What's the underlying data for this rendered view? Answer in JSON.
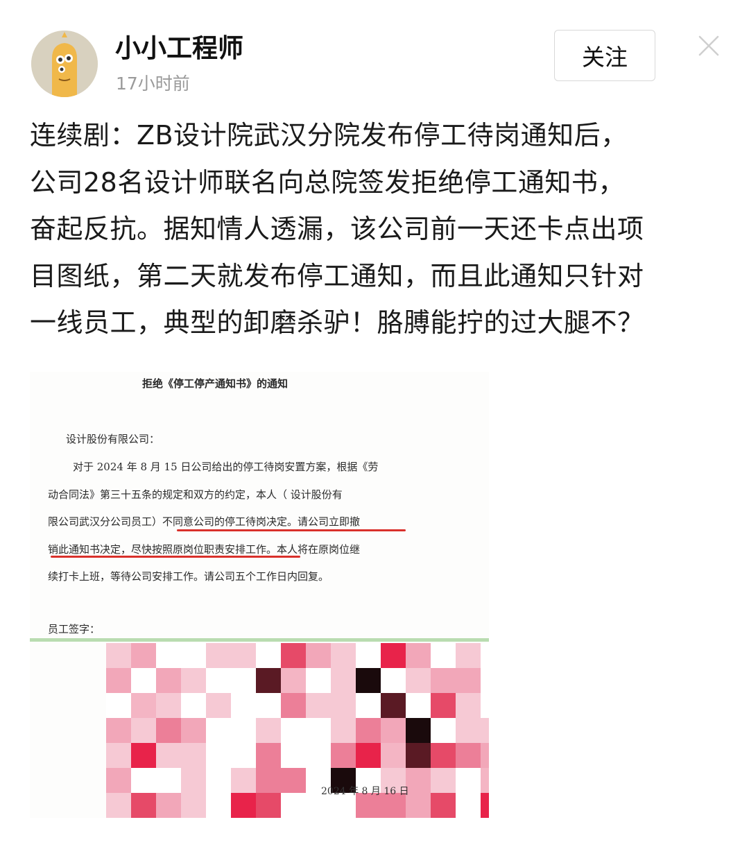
{
  "header": {
    "author_name": "小小工程师",
    "post_time": "17小时前",
    "follow_label": "关注",
    "avatar_icon": "avatar-character-icon",
    "close_icon": "close-icon"
  },
  "post": {
    "lines": [
      "连续剧：ZB设计院武汉分院发布停工待岗通知后，",
      "公司28名设计师联名向总院签发拒绝停工通知书，",
      "奋起反抗。据知情人透漏，该公司前一天还卡点出项",
      "目图纸，第二天就发布停工通知，而且此通知只针对",
      "一线员工，典型的卸磨杀驴！胳膊能拧的过大腿不？"
    ]
  },
  "document": {
    "title": "拒绝《停工停产通知书》的通知",
    "salutation": "设计股份有限公司：",
    "body_lines": [
      "对于 2024 年 8 月 15 日公司给出的停工待岗安置方案，根据《劳",
      "动合同法》第三十五条的规定和双方的约定，本人（    设计股份有",
      "限公司武汉分公司员工）不同意公司的停工待岗决定。请公司立即撤",
      "销此通知书决定，尽快按照原岗位职责安排工作。本人将在原岗位继",
      "续打卡上班，等待公司安排工作。请公司五个工作日内回复。"
    ],
    "signature_label": "员工签字：",
    "date": "2024 年 8 月 16 日",
    "colors": {
      "underline": "#d9302b",
      "divider": "#b9dcb0"
    }
  }
}
